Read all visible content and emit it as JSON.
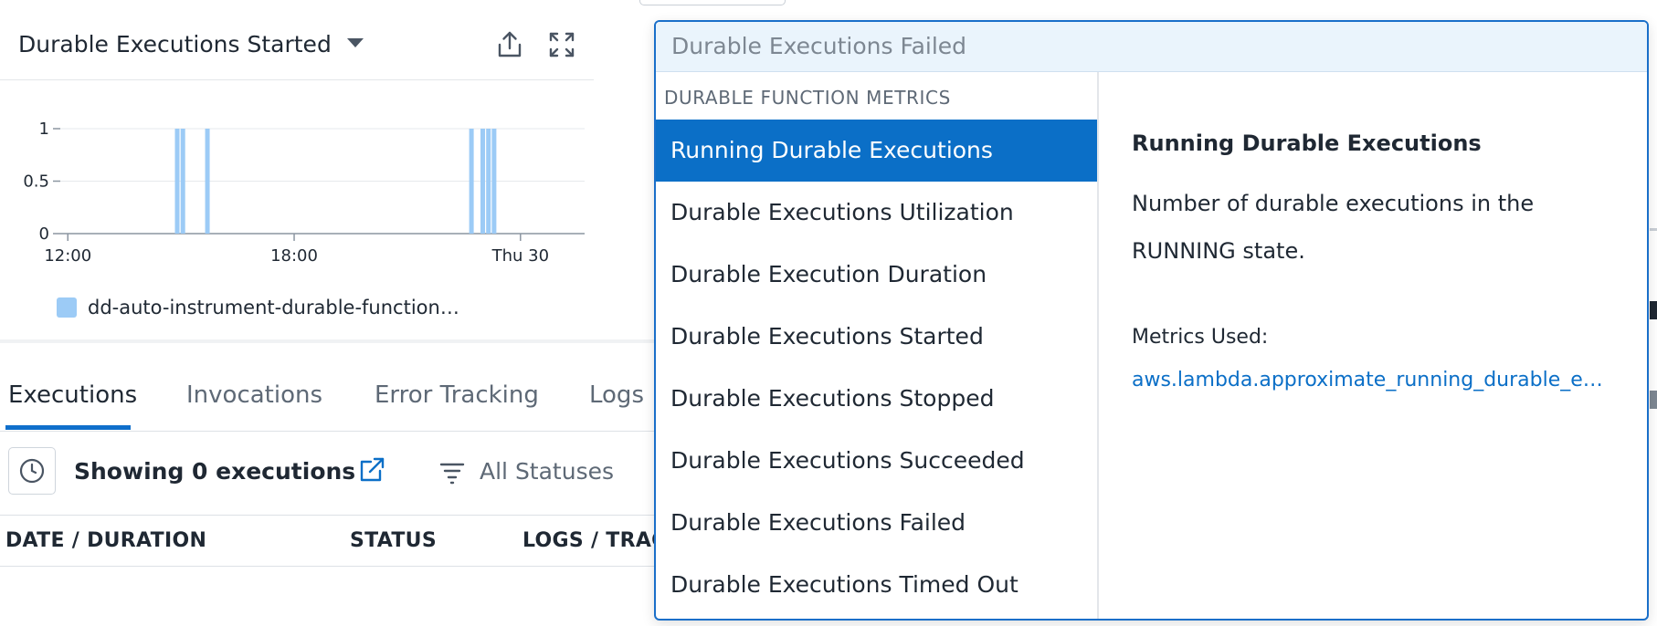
{
  "widget": {
    "title": "Durable Executions Started",
    "icons": [
      "share-icon",
      "expand-icon"
    ]
  },
  "chart_data": {
    "type": "bar",
    "y_ticks": [
      "1",
      "0.5",
      "0"
    ],
    "ylim": [
      0,
      1
    ],
    "x_ticks": [
      {
        "label": "12:00",
        "t": 12
      },
      {
        "label": "18:00",
        "t": 18
      },
      {
        "label": "Thu 30",
        "t": 24
      }
    ],
    "xlim": [
      11.8,
      25.7
    ],
    "series": [
      {
        "name": "dd-auto-instrument-durable-function…",
        "color": "#9ccbf6",
        "points": [
          {
            "t": 14.9,
            "value": 1
          },
          {
            "t": 15.05,
            "value": 1
          },
          {
            "t": 15.7,
            "value": 1
          },
          {
            "t": 22.7,
            "value": 1
          },
          {
            "t": 23.0,
            "value": 1
          },
          {
            "t": 23.15,
            "value": 1
          },
          {
            "t": 23.3,
            "value": 1
          }
        ]
      }
    ],
    "grid": true
  },
  "tabs": [
    "Executions",
    "Invocations",
    "Error Tracking",
    "Logs"
  ],
  "toolbar": {
    "showing": "Showing 0 executions",
    "statuses": "All Statuses"
  },
  "table": {
    "columns": [
      "DATE / DURATION",
      "STATUS",
      "LOGS / TRAC"
    ]
  },
  "dropdown": {
    "search_value": "Durable Executions Failed",
    "group_label": "DURABLE FUNCTION METRICS",
    "items": [
      "Running Durable Executions",
      "Durable Executions Utilization",
      "Durable Execution Duration",
      "Durable Executions Started",
      "Durable Executions Stopped",
      "Durable Executions Succeeded",
      "Durable Executions Failed",
      "Durable Executions Timed Out"
    ],
    "selected_index": 0,
    "detail": {
      "title": "Running Durable Executions",
      "description": "Number of durable executions in the RUNNING state.",
      "metrics_label": "Metrics Used:",
      "metric": "aws.lambda.approximate_running_durable_e…"
    }
  },
  "colors": {
    "accent": "#0b6fc7",
    "bar": "#9ccbf6",
    "dropdown_border": "#1a6fc9"
  }
}
